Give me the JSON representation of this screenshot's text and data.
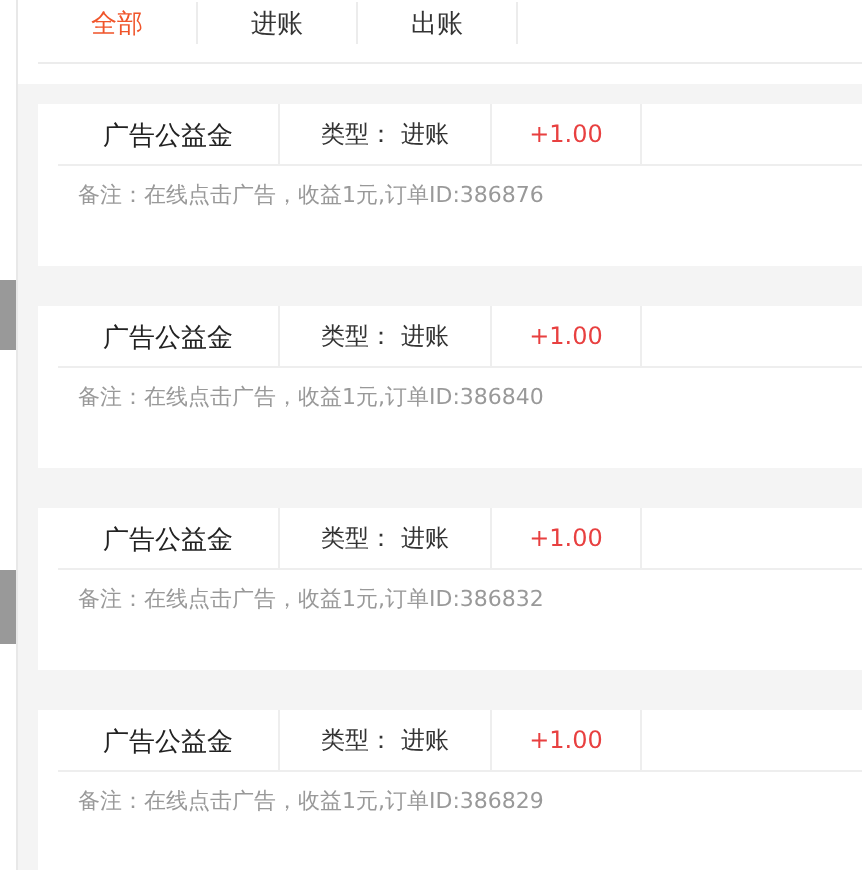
{
  "tabs": [
    {
      "label": "全部",
      "selected": true
    },
    {
      "label": "进账",
      "selected": false
    },
    {
      "label": "出账",
      "selected": false
    }
  ],
  "records": [
    {
      "name": "广告公益金",
      "type": "类型： 进账",
      "amount": "+1.00",
      "note": "备注：在线点击广告，收益1元,订单ID:386876"
    },
    {
      "name": "广告公益金",
      "type": "类型： 进账",
      "amount": "+1.00",
      "note": "备注：在线点击广告，收益1元,订单ID:386840"
    },
    {
      "name": "广告公益金",
      "type": "类型： 进账",
      "amount": "+1.00",
      "note": "备注：在线点击广告，收益1元,订单ID:386832"
    },
    {
      "name": "广告公益金",
      "type": "类型： 进账",
      "amount": "+1.00",
      "note": "备注：在线点击广告，收益1元,订单ID:386829"
    }
  ]
}
